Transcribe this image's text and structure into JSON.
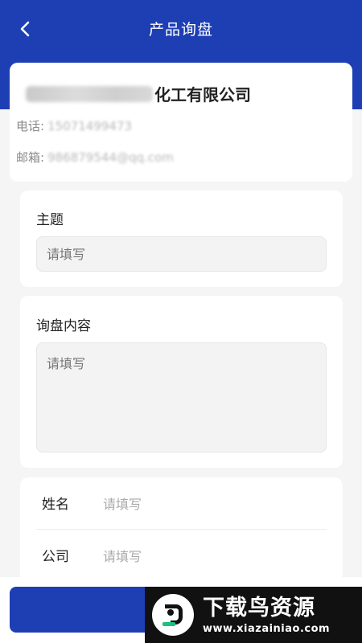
{
  "nav": {
    "title": "产品询盘",
    "back_icon": "chevron-left-icon"
  },
  "company": {
    "name_visible": "化工有限公司",
    "phone_label": "电话:",
    "phone_value": "15071499473",
    "email_label": "邮箱:",
    "email_value": "986879544@qq.com"
  },
  "subject": {
    "label": "主题",
    "placeholder": "请填写"
  },
  "content": {
    "label": "询盘内容",
    "placeholder": "请填写"
  },
  "contact": {
    "name_label": "姓名",
    "name_placeholder": "请填写",
    "company_label": "公司",
    "company_placeholder": "请填写"
  },
  "watermark": {
    "title": "下载鸟资源",
    "url": "www.xiazainiao.com"
  },
  "colors": {
    "primary": "#1e3fb4",
    "background": "#f5f5f5"
  }
}
